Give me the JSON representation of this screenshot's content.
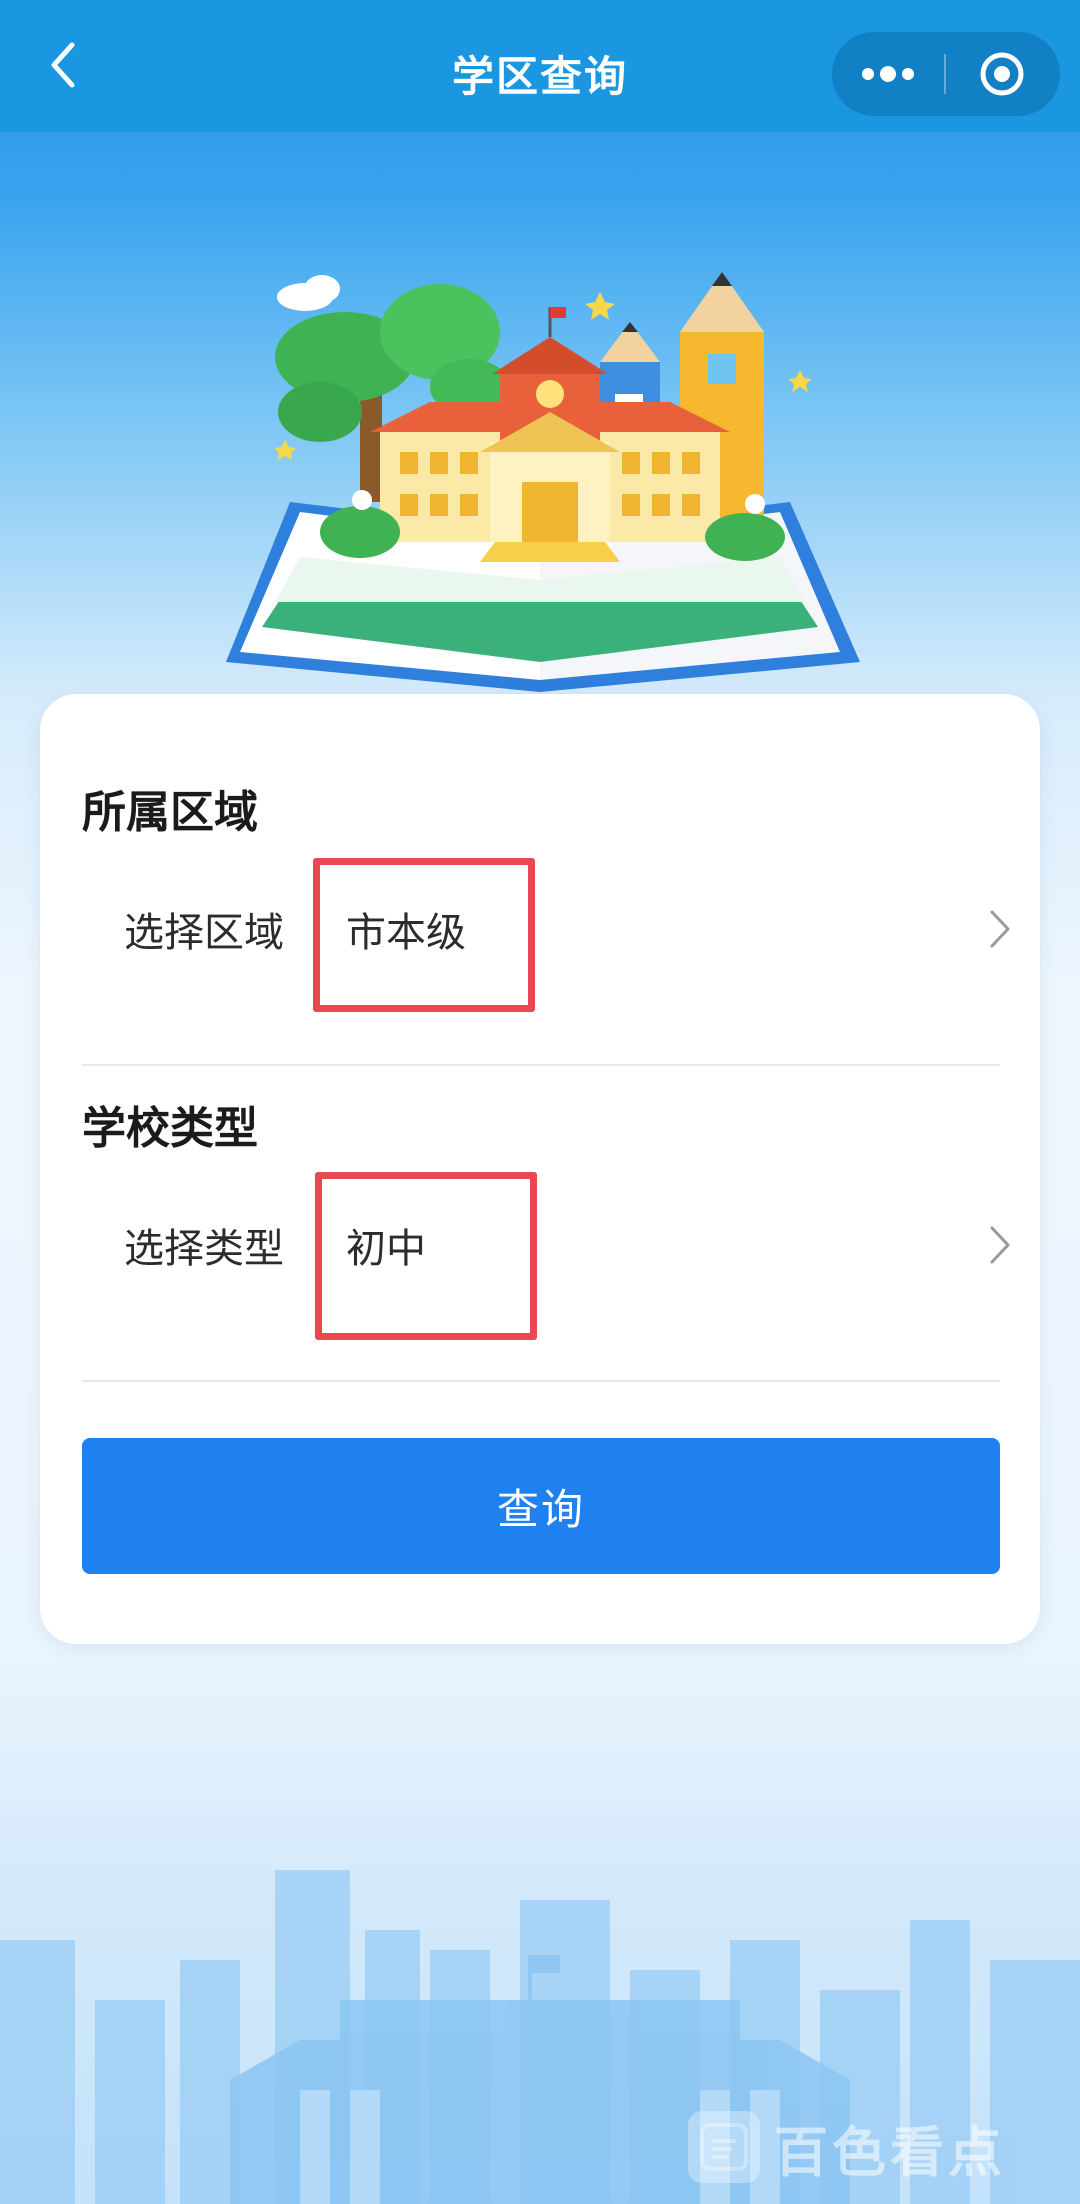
{
  "navbar": {
    "title": "学区查询",
    "back_icon": "chevron-left-icon",
    "more_icon": "more-dots-icon",
    "close_icon": "target-circle-icon"
  },
  "form": {
    "region": {
      "section_title": "所属区域",
      "label": "选择区域",
      "value": "市本级"
    },
    "school_type": {
      "section_title": "学校类型",
      "label": "选择类型",
      "value": "初中"
    },
    "submit_label": "查询"
  },
  "watermark": {
    "text": "百色看点",
    "icon_text": "百色看点"
  },
  "colors": {
    "navbar": "#1a97e0",
    "button": "#1f80f0",
    "highlight": "#e8484f"
  }
}
